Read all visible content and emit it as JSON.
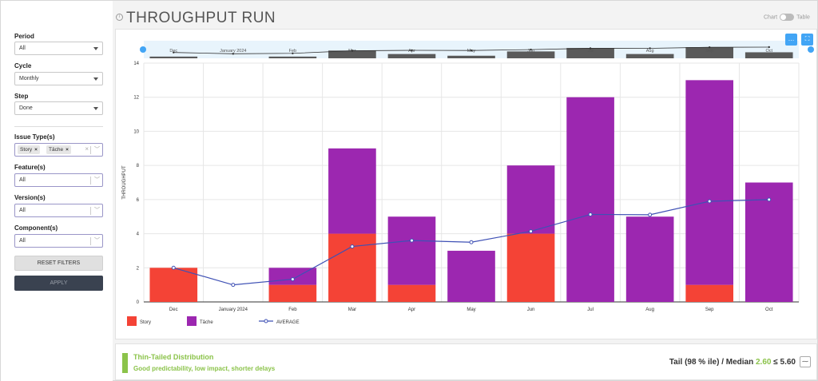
{
  "page": {
    "title": "THROUGHPUT RUN",
    "view_toggle": {
      "chart_label": "Chart",
      "table_label": "Table"
    }
  },
  "sidebar": {
    "period": {
      "label": "Period",
      "value": "All"
    },
    "cycle": {
      "label": "Cycle",
      "value": "Monthly"
    },
    "step": {
      "label": "Step",
      "value": "Done"
    },
    "issue_types": {
      "label": "Issue Type(s)",
      "tags": [
        "Story",
        "Tâche"
      ]
    },
    "feature": {
      "label": "Feature(s)",
      "value": "All"
    },
    "version": {
      "label": "Version(s)",
      "value": "All"
    },
    "component": {
      "label": "Component(s)",
      "value": "All"
    },
    "reset_label": "RESET FILTERS",
    "apply_label": "APPLY"
  },
  "toolbar": {
    "zoom_icon": "dots-icon",
    "fullscreen_icon": "fullscreen-icon",
    "zoom_glyph": "…",
    "fullscreen_glyph": "⛶"
  },
  "chart_data": {
    "type": "bar",
    "stacked": true,
    "categories": [
      "Dec",
      "January 2024",
      "Feb",
      "Mar",
      "Apr",
      "May",
      "Jun",
      "Jul",
      "Aug",
      "Sep",
      "Oct"
    ],
    "series": [
      {
        "name": "Story",
        "values": [
          2,
          0,
          1,
          4,
          1,
          0,
          4,
          0,
          0,
          1,
          0
        ],
        "color": "#f44336"
      },
      {
        "name": "Tâche",
        "values": [
          0,
          0,
          1,
          5,
          4,
          3,
          4,
          12,
          5,
          12,
          7
        ],
        "color": "#9c27b0"
      }
    ],
    "line": {
      "name": "AVERAGE",
      "values": [
        2,
        1,
        1.33,
        3.25,
        3.6,
        3.5,
        4.14,
        5.13,
        5.11,
        5.9,
        6.0
      ],
      "color": "#3f51b5"
    },
    "ylabel": "THROUGHPUT",
    "ylim": [
      0,
      14
    ],
    "yticks": [
      0,
      2,
      4,
      6,
      8,
      10,
      12,
      14
    ],
    "grid": true,
    "legend_placement": "bottom-left"
  },
  "footer": {
    "title": "Thin-Tailed Distribution",
    "subtitle": "Good predictability, low impact, shorter delays",
    "tail_prefix": "Tail (98 % ile) / Median",
    "median_value": "2.60",
    "ratio_sep": "≤",
    "ratio_limit": "5.60",
    "icon": "line-chart-icon"
  },
  "colors": {
    "accent_green": "#8bc34a",
    "accent_blue": "#42a5f5"
  }
}
